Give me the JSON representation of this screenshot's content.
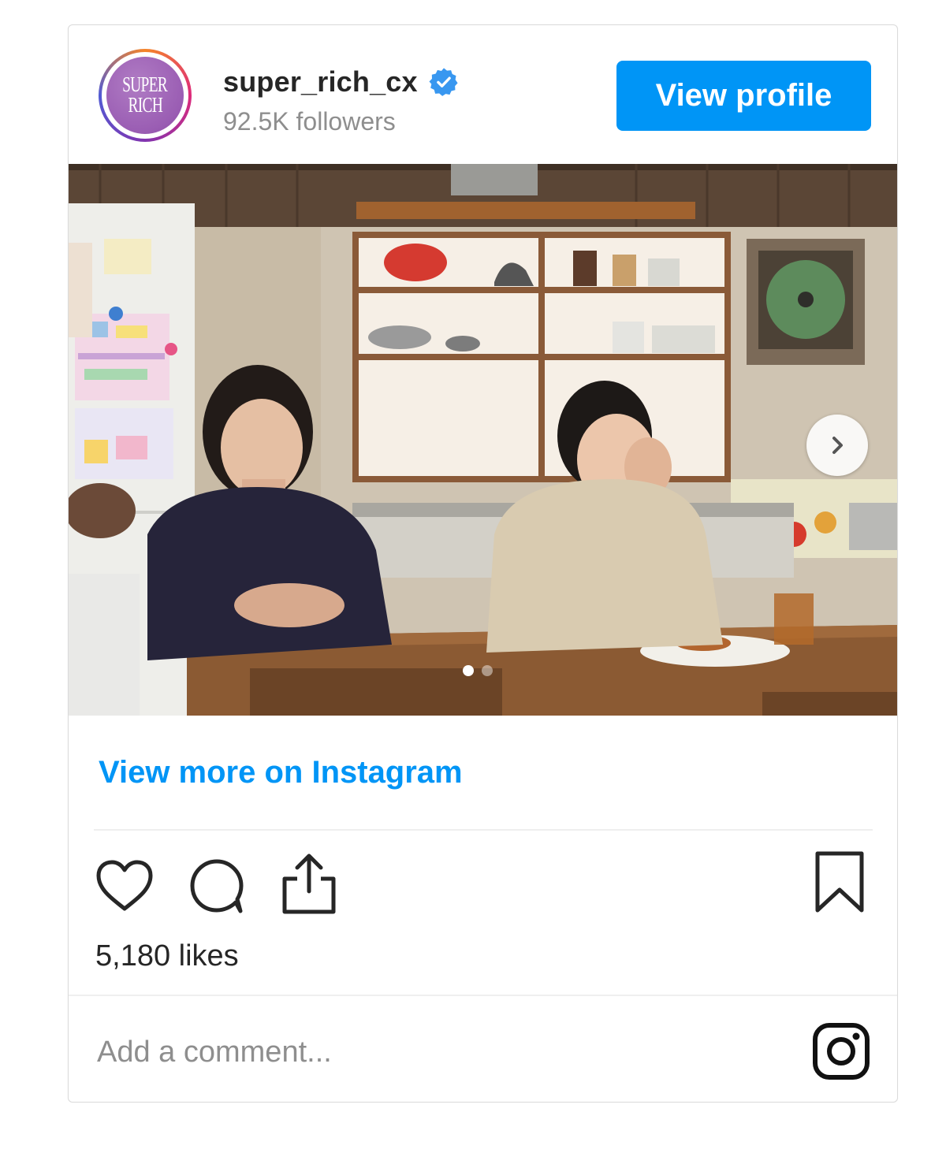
{
  "header": {
    "avatar_text_line1": "SUPER",
    "avatar_text_line2": "RICH",
    "username": "super_rich_cx",
    "verified_icon": "verified-badge-icon",
    "followers": "92.5K followers",
    "view_profile_label": "View profile"
  },
  "media": {
    "carousel_dot_count": 2,
    "active_dot": 1,
    "next_icon": "chevron-right-icon"
  },
  "view_more_label": "View more on Instagram",
  "actions": {
    "like_icon": "heart-icon",
    "comment_icon": "comment-icon",
    "share_icon": "share-icon",
    "save_icon": "bookmark-icon"
  },
  "likes": "5,180 likes",
  "comment": {
    "placeholder": "Add a comment..."
  },
  "footer_icon": "instagram-logo-icon",
  "colors": {
    "accent": "#0095f6",
    "text": "#262626",
    "muted": "#8e8e8e",
    "border": "#dbdbdb"
  }
}
